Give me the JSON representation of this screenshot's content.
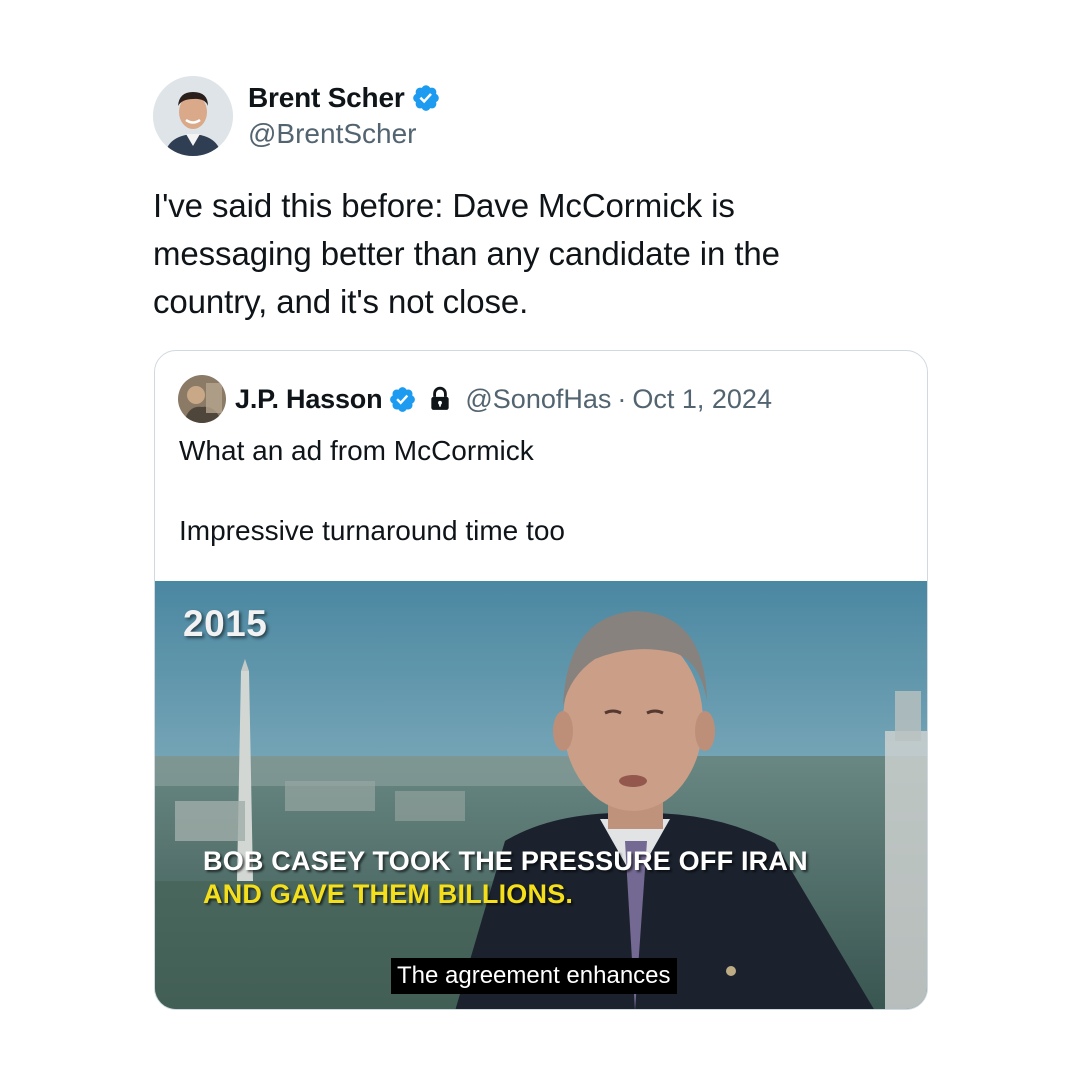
{
  "tweet": {
    "author": {
      "display_name": "Brent Scher",
      "handle": "@BrentScher",
      "verified": true,
      "avatar_icon": "person-avatar"
    },
    "text": "I've said this before: Dave McCormick is messaging better than any candidate in the country, and it's not close."
  },
  "quoted_tweet": {
    "author": {
      "display_name": "J.P. Hasson",
      "handle": "@SonofHas",
      "verified": true,
      "protected": true,
      "avatar_icon": "person-avatar"
    },
    "separator": "·",
    "date": "Oct 1, 2024",
    "text_lines": [
      "What an ad from McCormick",
      "Impressive turnaround time too"
    ],
    "media": {
      "year_label": "2015",
      "headline_line1": "BOB CASEY TOOK THE PRESSURE OFF IRAN",
      "headline_line2": "AND GAVE THEM BILLIONS.",
      "caption": "The agreement enhances"
    }
  },
  "colors": {
    "verified_blue": "#1d9bf0",
    "secondary_text": "#536471",
    "border": "#cfd9de",
    "headline_yellow": "#f5df1a"
  }
}
